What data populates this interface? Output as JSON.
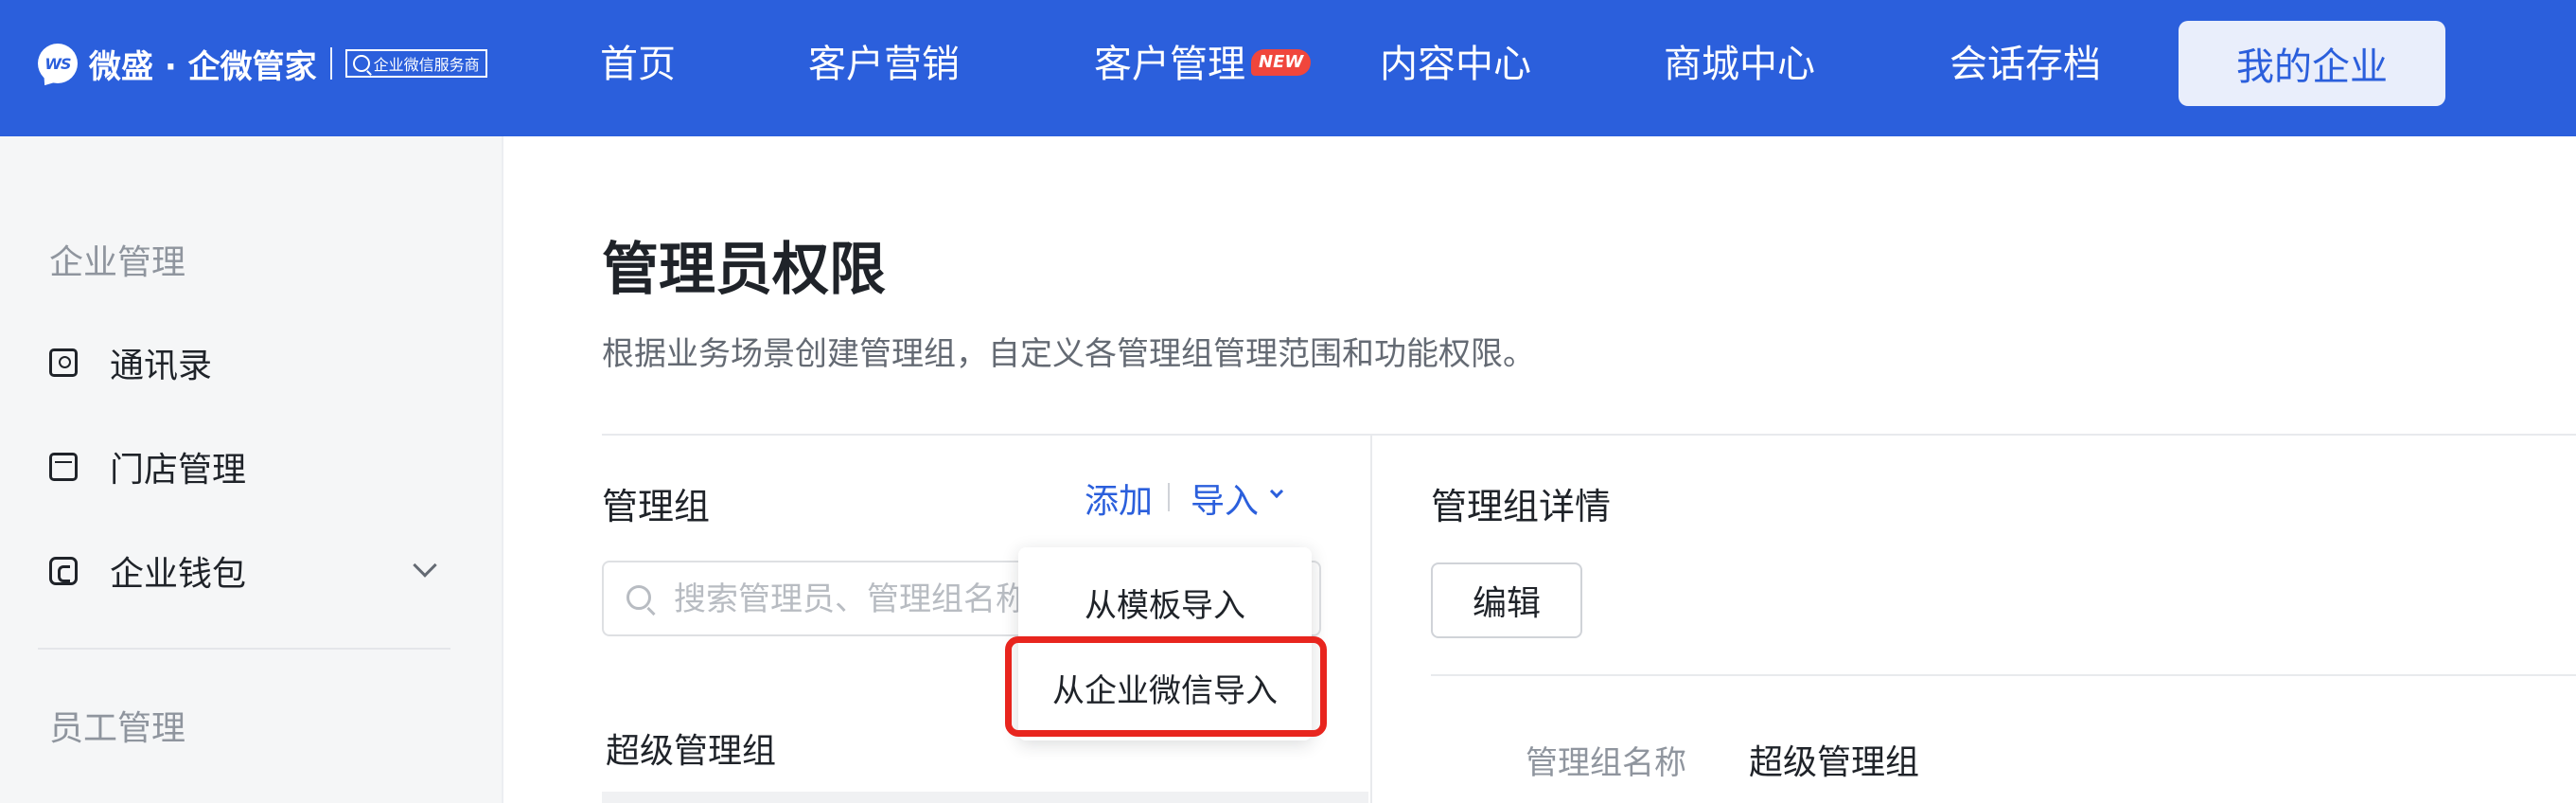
{
  "brand": {
    "logo_text": "WS",
    "name": "微盛 · 企微管家",
    "tag": "企业微信服务商"
  },
  "nav": {
    "items": [
      {
        "label": "首页"
      },
      {
        "label": "客户营销"
      },
      {
        "label": "客户管理",
        "badge": "NEW"
      },
      {
        "label": "内容中心"
      },
      {
        "label": "商城中心"
      },
      {
        "label": "会话存档"
      }
    ],
    "active": "我的企业"
  },
  "sidebar": {
    "group1": "企业管理",
    "items": [
      {
        "label": "通讯录",
        "icon": "contacts-icon"
      },
      {
        "label": "门店管理",
        "icon": "store-icon"
      },
      {
        "label": "企业钱包",
        "icon": "wallet-icon"
      }
    ],
    "group2": "员工管理"
  },
  "page": {
    "title": "管理员权限",
    "description": "根据业务场景创建管理组，自定义各管理组管理范围和功能权限。"
  },
  "group_panel": {
    "title": "管理组",
    "add_label": "添加",
    "import_label": "导入",
    "search_placeholder": "搜索管理员、管理组名称",
    "items": [
      {
        "label": "超级管理组"
      }
    ]
  },
  "import_menu": {
    "items": [
      {
        "label": "从模板导入"
      },
      {
        "label": "从企业微信导入"
      }
    ],
    "highlight_color": "#e8251e"
  },
  "detail_panel": {
    "title": "管理组详情",
    "edit_label": "编辑",
    "fields": [
      {
        "label": "管理组名称",
        "value": "超级管理组"
      }
    ]
  },
  "colors": {
    "primary": "#2b5fdc",
    "badge": "#f0463c"
  }
}
